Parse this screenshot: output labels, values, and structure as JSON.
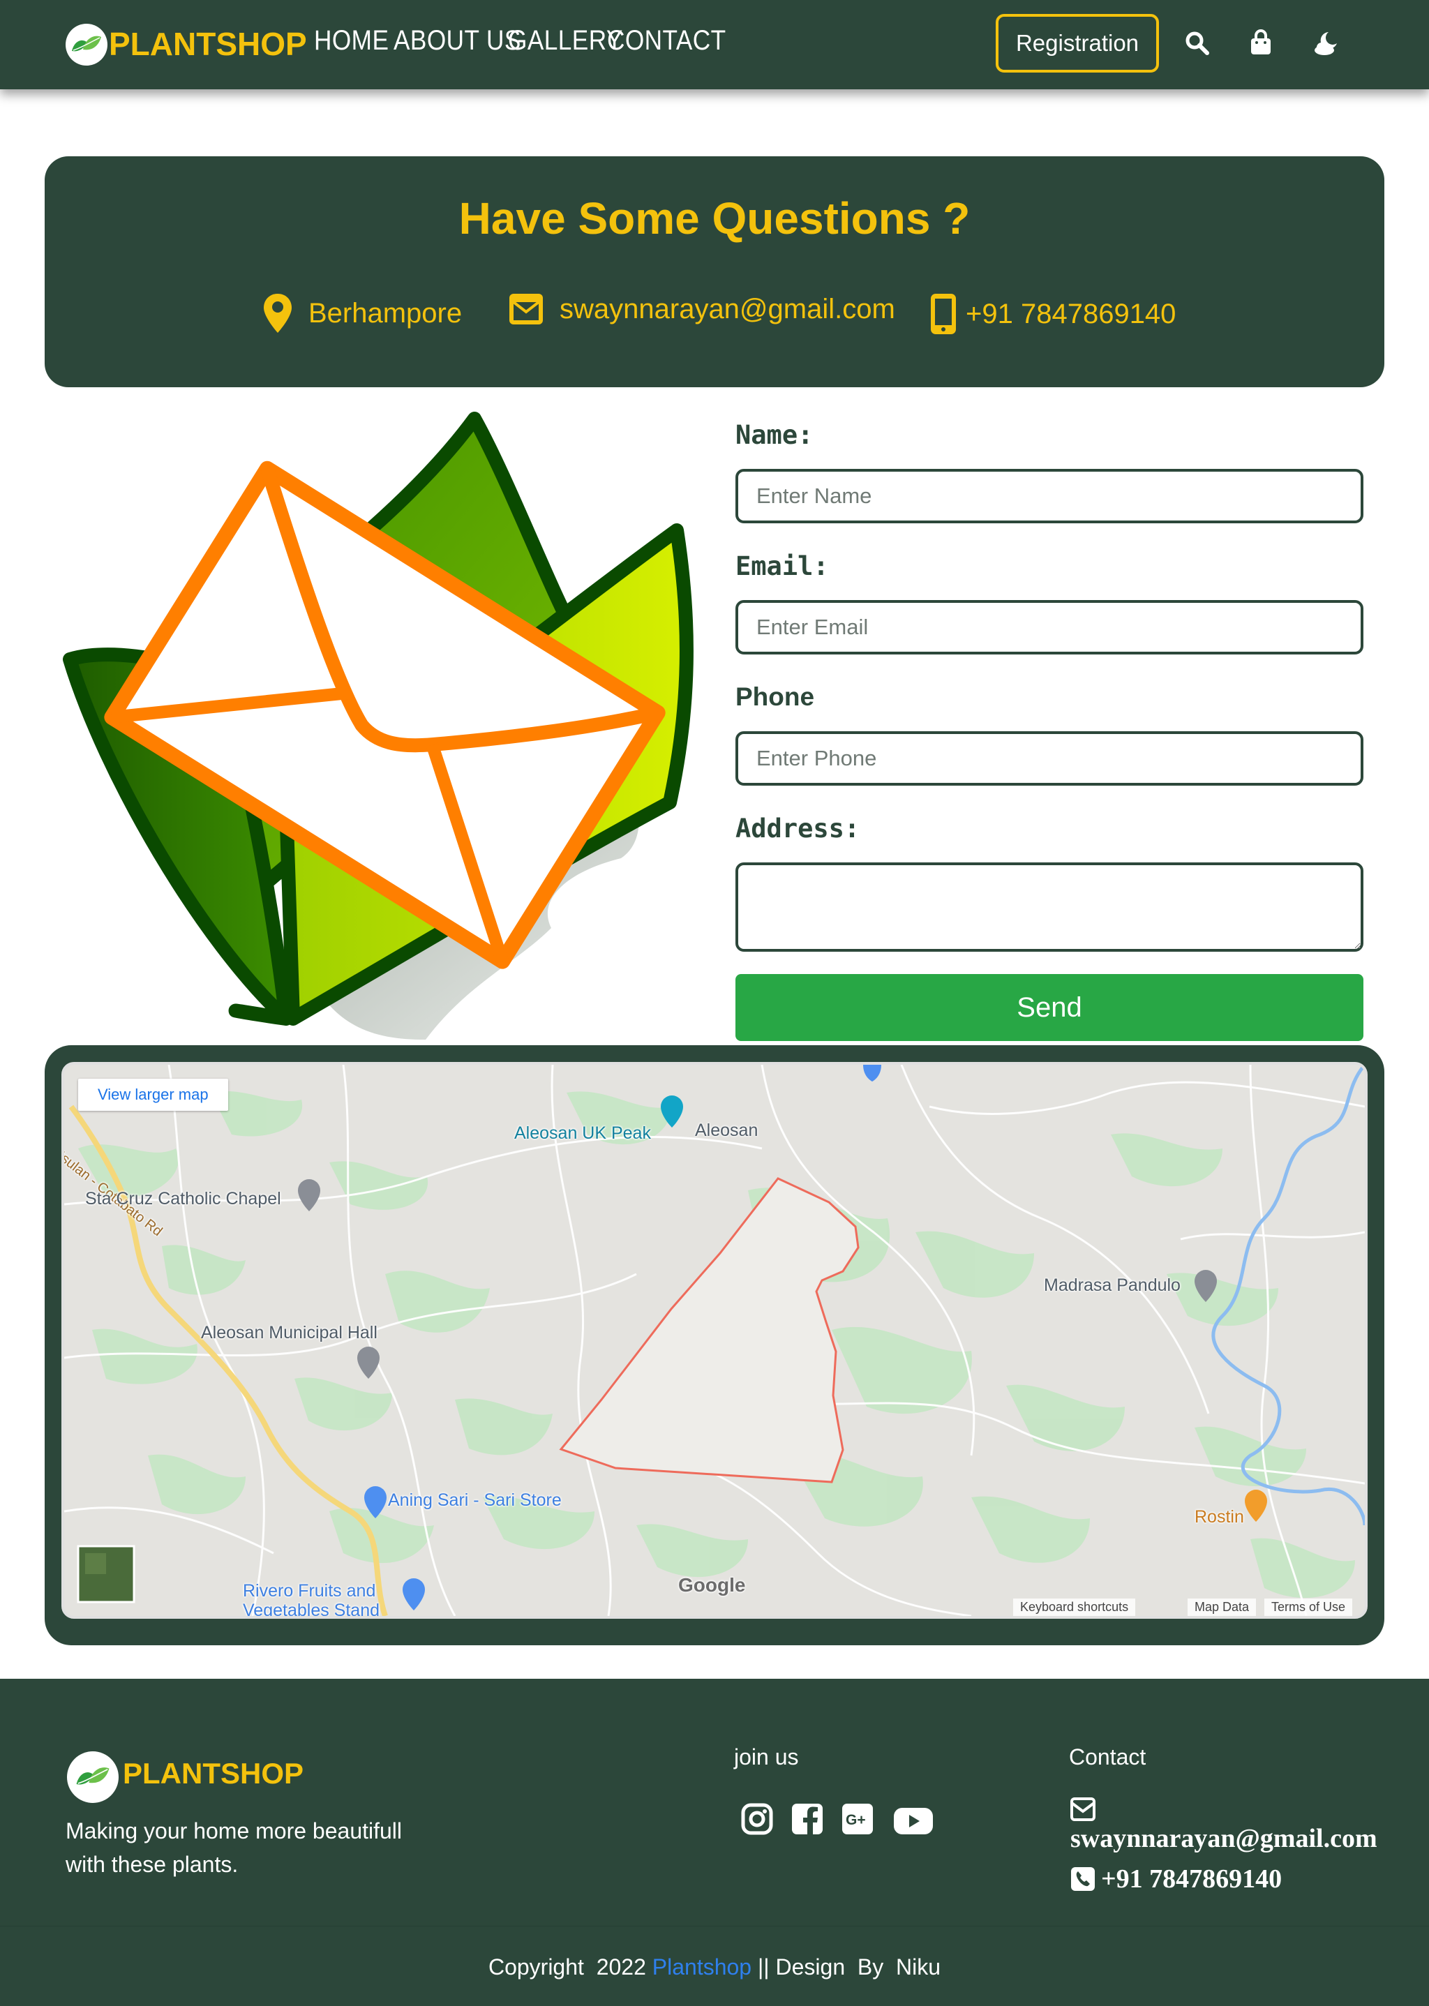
{
  "nav": {
    "brand": "PLANTSHOP",
    "links": [
      "HOME",
      "ABOUT US",
      "GALLERY",
      "CONTACT"
    ],
    "register_label": "Registration",
    "icons": [
      "search-icon",
      "shopping-bag-icon",
      "moon-cloud-icon"
    ]
  },
  "questions": {
    "title": "Have Some Questions ?",
    "location": "Berhampore",
    "email": "swaynnarayan@gmail.com",
    "phone": "+91 7847869140"
  },
  "form": {
    "name_label": "Name:",
    "name_placeholder": "Enter Name",
    "email_label": "Email:",
    "email_placeholder": "Enter Email",
    "phone_label": "Phone",
    "phone_placeholder": "Enter Phone",
    "address_label": "Address:",
    "send_label": "Send"
  },
  "map": {
    "larger_map": "View larger map",
    "road_label": "Isulan - Cotabato Rd",
    "places": {
      "chapel": "Sta Cruz Catholic Chapel",
      "peak": "Aleosan UK Peak",
      "town": "Aleosan",
      "madrasa": "Madrasa Pandulo",
      "hall": "Aleosan Municipal Hall",
      "store": "Aning Sari - Sari Store",
      "rostin": "Rostin",
      "fruits_line1": "Rivero Fruits and",
      "fruits_line2": "Vegetables Stand"
    },
    "google": "Google",
    "shortcuts": "Keyboard shortcuts",
    "map_data": "Map Data",
    "terms": "Terms of Use"
  },
  "footer": {
    "brand": "PLANTSHOP",
    "tagline_line1": "Making your home more beautifull",
    "tagline_line2": "with these plants.",
    "join_title": "join us",
    "social_icons": [
      "instagram-icon",
      "facebook-icon",
      "google-plus-icon",
      "youtube-icon"
    ],
    "contact_title": "Contact",
    "email": "swaynnarayan@gmail.com",
    "phone": "+91 7847869140",
    "copyright_prefix": "Copyright  2022 ",
    "copyright_brand": "Plantshop",
    "copyright_suffix": " || Design  By  Niku"
  },
  "colors": {
    "primary_dark_green": "#2c473a",
    "accent_yellow": "#f4c20d",
    "send_green": "#28a745",
    "link_blue": "#2f80ed"
  }
}
